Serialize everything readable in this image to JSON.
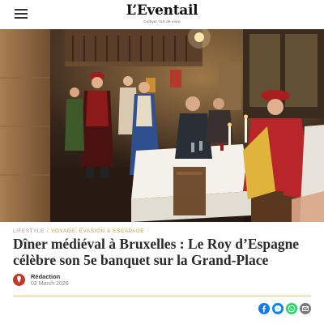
{
  "header": {
    "logo": "L’Eventail",
    "tagline": "Cultiver l’art de vivre",
    "menu_icon": "hamburger-menu-icon"
  },
  "hero": {
    "icon": "hero-photo"
  },
  "article": {
    "category_primary": "LIFESTYLE",
    "category_separator": "/",
    "category_secondary": "VOYAGE, ÉVASION & ESCAPADE",
    "title": "Dîner médiéval à Bruxelles : Le Roy d’Espagne célèbre son 5e banquet sur la Grand-Place"
  },
  "author": {
    "name": "Rédaction",
    "date": "02 March 2026",
    "avatar_icon": "avatar-icon",
    "avatar_color": "#c0392b"
  },
  "share": {
    "buttons": [
      {
        "icon": "facebook-icon",
        "color": "#1877f2"
      },
      {
        "icon": "messenger-icon",
        "color": "#0084ff"
      },
      {
        "icon": "whatsapp-icon",
        "color": "#25d366"
      },
      {
        "icon": "email-icon",
        "color": "#7a7a7a"
      }
    ]
  },
  "colors": {
    "accent_gold": "#c9a24b",
    "divider": "#e7c95a"
  }
}
